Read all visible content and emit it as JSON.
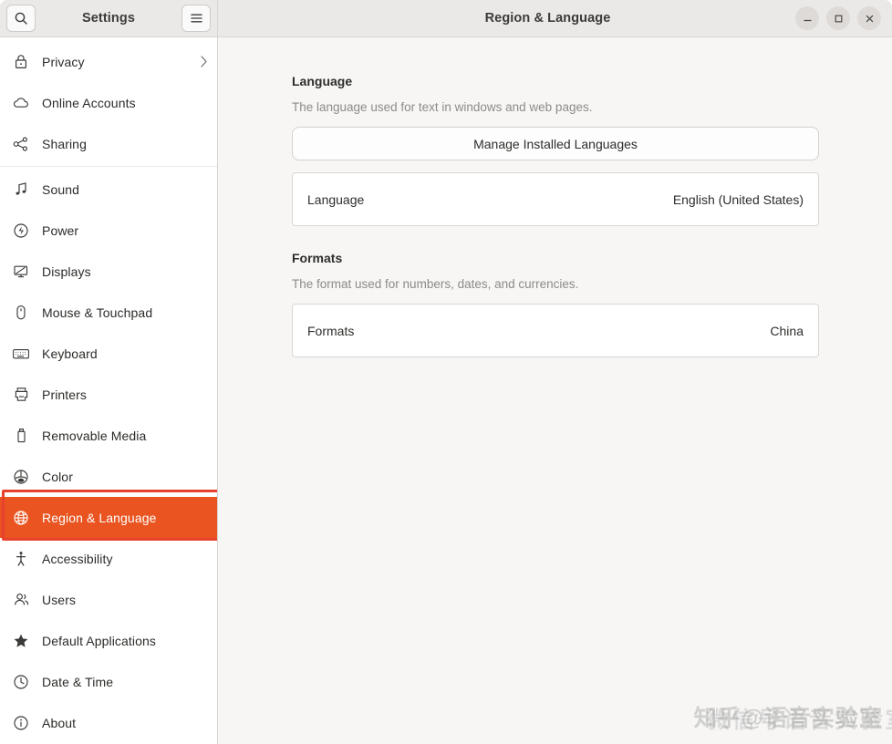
{
  "window": {
    "title": "Region & Language",
    "sidebar_title": "Settings",
    "controls": {
      "minimize": "minimize-button",
      "maximize": "maximize-button",
      "close": "close-button"
    },
    "search_button": "search-icon",
    "menu_button": "hamburger-menu-icon"
  },
  "sidebar": {
    "groups": [
      {
        "items": [
          {
            "label": "Privacy",
            "icon": "lock-icon",
            "has_chevron": true
          },
          {
            "label": "Online Accounts",
            "icon": "cloud-icon"
          },
          {
            "label": "Sharing",
            "icon": "share-nodes-icon"
          }
        ]
      },
      {
        "items": [
          {
            "label": "Sound",
            "icon": "music-note-icon"
          },
          {
            "label": "Power",
            "icon": "power-icon"
          },
          {
            "label": "Displays",
            "icon": "display-icon"
          },
          {
            "label": "Mouse & Touchpad",
            "icon": "mouse-icon"
          },
          {
            "label": "Keyboard",
            "icon": "keyboard-icon"
          },
          {
            "label": "Printers",
            "icon": "printer-icon"
          },
          {
            "label": "Removable Media",
            "icon": "usb-drive-icon"
          },
          {
            "label": "Color",
            "icon": "color-icon"
          },
          {
            "label": "Region & Language",
            "icon": "globe-icon",
            "selected": true
          },
          {
            "label": "Accessibility",
            "icon": "accessibility-icon"
          },
          {
            "label": "Users",
            "icon": "users-icon"
          },
          {
            "label": "Default Applications",
            "icon": "star-icon"
          },
          {
            "label": "Date & Time",
            "icon": "clock-icon"
          },
          {
            "label": "About",
            "icon": "info-icon"
          }
        ]
      }
    ]
  },
  "main": {
    "sections": [
      {
        "title": "Language",
        "description": "The language used for text in windows and web pages.",
        "button": "Manage Installed Languages",
        "row": {
          "label": "Language",
          "value": "English (United States)"
        }
      },
      {
        "title": "Formats",
        "description": "The format used for numbers, dates, and currencies.",
        "row": {
          "label": "Formats",
          "value": "China"
        }
      }
    ]
  },
  "watermark": {
    "text_a": "知乎@语音实验室",
    "text_b": "微信号语音实验室"
  },
  "colors": {
    "accent": "#e95420",
    "annotation": "#e8422f",
    "titlebar": "#ebe9e7",
    "content_bg": "#f7f6f5"
  }
}
